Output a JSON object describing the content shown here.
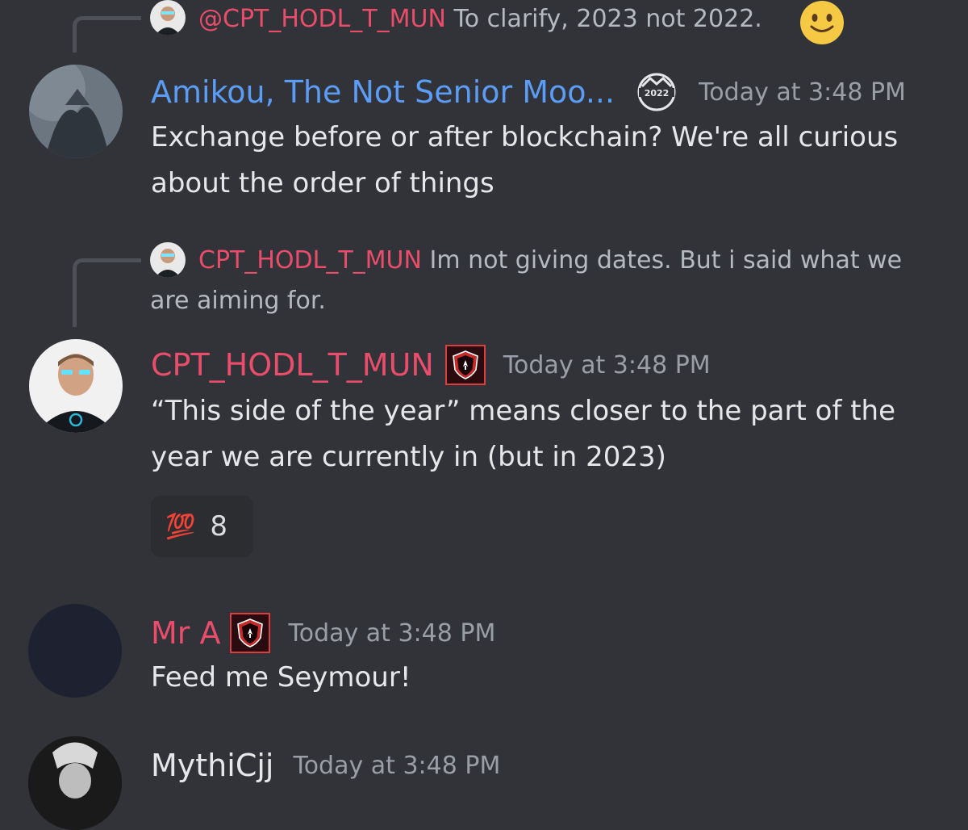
{
  "messages": [
    {
      "reply": {
        "author": "@CPT_HODL_T_MUN",
        "text": "To clarify, 2023 not 2022."
      },
      "author": "Amikou, The Not Senior Moo...",
      "author_color": "#5b9cf5",
      "timestamp": "Today at 3:48 PM",
      "lines": [
        "Exchange before or after blockchain? We're all curious",
        "about the order of things"
      ]
    },
    {
      "reply": {
        "author": "CPT_HODL_T_MUN",
        "text_line1": "Im not giving dates.  But i said what we",
        "text_line2": "are aiming for."
      },
      "author": "CPT_HODL_T_MUN",
      "author_color": "#e84d6b",
      "timestamp": "Today at 3:48 PM",
      "lines": [
        "“This side of the year” means closer to the part of the",
        "year we are currently in (but in 2023)"
      ],
      "reaction": {
        "emoji": "💯",
        "count": "8"
      }
    },
    {
      "author": "Mr A",
      "author_color": "#e84d6b",
      "timestamp": "Today at 3:48 PM",
      "lines": [
        "Feed me Seymour!"
      ]
    },
    {
      "author": "MythiCjj",
      "author_color": "#e6e7e9",
      "timestamp": "Today at 3:48 PM"
    }
  ]
}
